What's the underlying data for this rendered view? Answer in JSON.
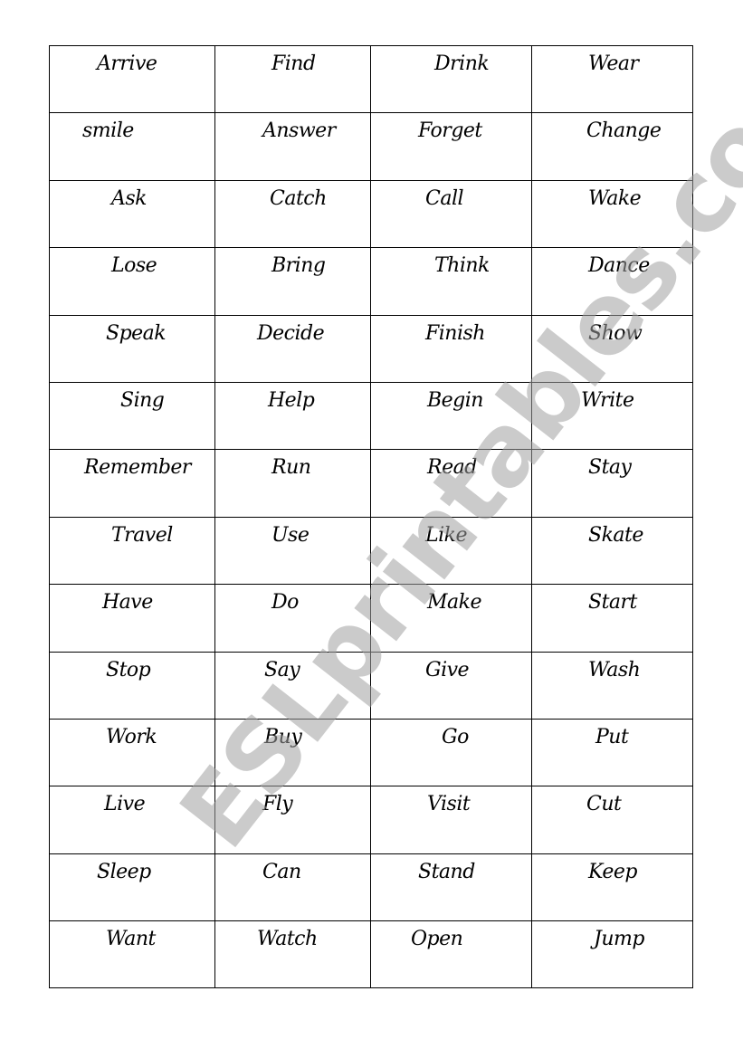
{
  "document": {
    "type": "verb card table",
    "rows": [
      [
        "Arrive",
        "Find",
        "Drink",
        "Wear"
      ],
      [
        "smile",
        "Answer",
        "Forget",
        "Change"
      ],
      [
        "Ask",
        "Catch",
        "Call",
        "Wake"
      ],
      [
        "Lose",
        "Bring",
        "Think",
        "Dance"
      ],
      [
        "Speak",
        "Decide",
        "Finish",
        "Show"
      ],
      [
        "Sing",
        "Help",
        "Begin",
        "Write"
      ],
      [
        "Remember",
        "Run",
        "Read",
        "Stay"
      ],
      [
        "Travel",
        "Use",
        "Like",
        "Skate"
      ],
      [
        "Have",
        "Do",
        "Make",
        "Start"
      ],
      [
        "Stop",
        "Say",
        "Give",
        "Wash"
      ],
      [
        "Work",
        "Buy",
        "Go",
        "Put"
      ],
      [
        "Live",
        "Fly",
        "Visit",
        "Cut"
      ],
      [
        "Sleep",
        "Can",
        "Stand",
        "Keep"
      ],
      [
        "Want",
        "Watch",
        "Open",
        "Jump"
      ]
    ]
  },
  "watermark": {
    "text": "ESLprintables.com",
    "color": "#a0a0a0"
  }
}
